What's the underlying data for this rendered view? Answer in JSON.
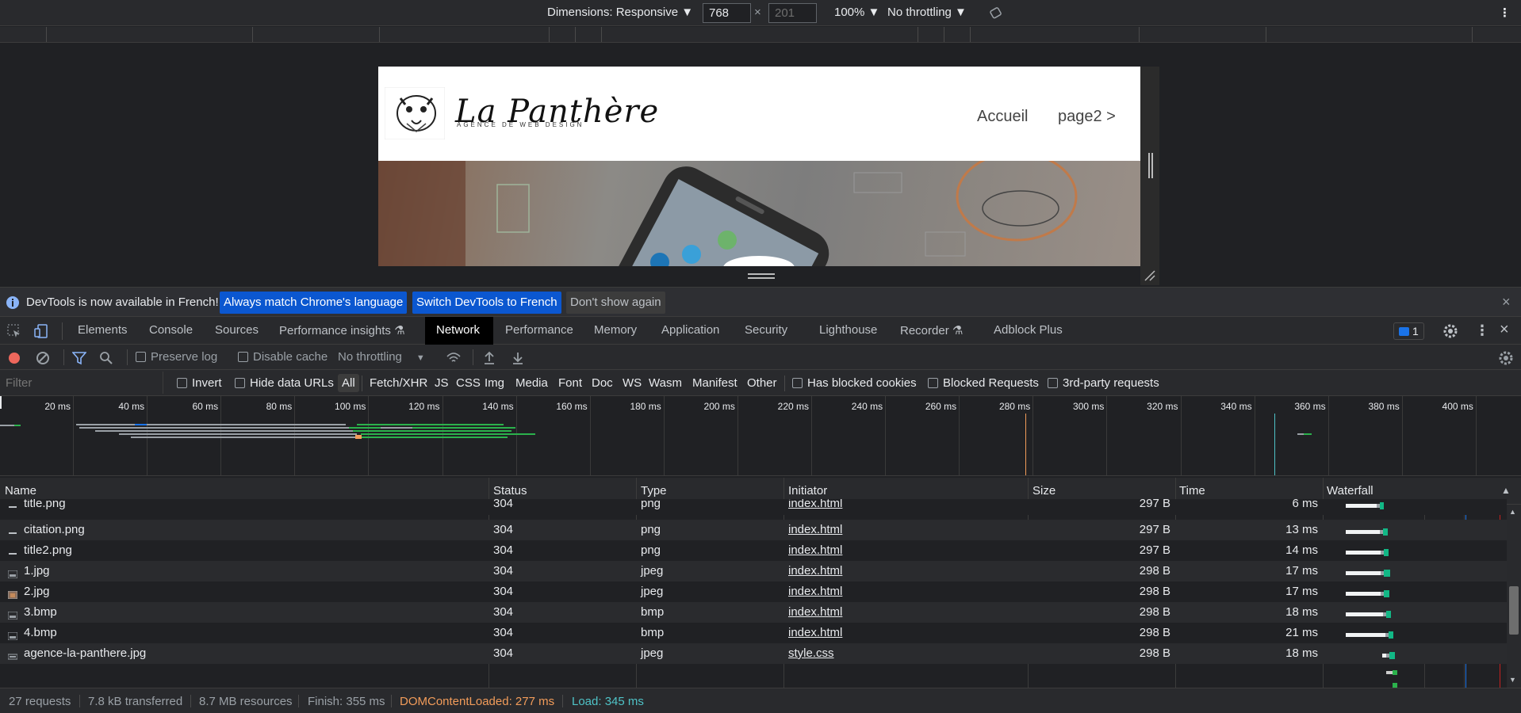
{
  "device_toolbar": {
    "dimensions_label": "Dimensions: Responsive ▼",
    "width_value": "768",
    "times": "×",
    "height_placeholder": "201",
    "zoom": "100% ▼",
    "throttling": "No throttling ▼",
    "more": "⋮"
  },
  "site": {
    "title": "La Panthère",
    "subtitle": "AGENCE DE WEB DESIGN",
    "nav": [
      "Accueil",
      "page2 >"
    ]
  },
  "infobar": {
    "message": "DevTools is now available in French!",
    "btn_match": "Always match Chrome's language",
    "btn_switch": "Switch DevTools to French",
    "btn_dismiss": "Don't show again",
    "close": "×"
  },
  "tabs": [
    "Elements",
    "Console",
    "Sources",
    "Performance insights ⚗",
    "Network",
    "Performance",
    "Memory",
    "Application",
    "Security",
    "Lighthouse",
    "Recorder ⚗",
    "Adblock Plus"
  ],
  "active_tab": "Network",
  "issues_count": "1",
  "network_toolbar": {
    "preserve_log": "Preserve log",
    "disable_cache": "Disable cache",
    "throttling": "No throttling"
  },
  "filter_bar": {
    "placeholder": "Filter",
    "invert": "Invert",
    "hide_data_urls": "Hide data URLs",
    "types": [
      "All",
      "Fetch/XHR",
      "JS",
      "CSS",
      "Img",
      "Media",
      "Font",
      "Doc",
      "WS",
      "Wasm",
      "Manifest",
      "Other"
    ],
    "has_blocked_cookies": "Has blocked cookies",
    "blocked_requests": "Blocked Requests",
    "third_party": "3rd-party requests"
  },
  "overview_ticks": [
    "20 ms",
    "40 ms",
    "60 ms",
    "80 ms",
    "100 ms",
    "120 ms",
    "140 ms",
    "160 ms",
    "180 ms",
    "200 ms",
    "220 ms",
    "240 ms",
    "260 ms",
    "280 ms",
    "300 ms",
    "320 ms",
    "340 ms",
    "360 ms",
    "380 ms",
    "400 ms",
    "4"
  ],
  "columns": [
    "Name",
    "Status",
    "Type",
    "Initiator",
    "Size",
    "Time",
    "Waterfall"
  ],
  "rows": [
    {
      "name": "title.png",
      "status": "304",
      "type": "png",
      "initiator": "index.html",
      "size": "297 B",
      "time": "6 ms",
      "icon": "dash"
    },
    {
      "name": "citation.png",
      "status": "304",
      "type": "png",
      "initiator": "index.html",
      "size": "297 B",
      "time": "13 ms",
      "icon": "dash"
    },
    {
      "name": "title2.png",
      "status": "304",
      "type": "png",
      "initiator": "index.html",
      "size": "297 B",
      "time": "14 ms",
      "icon": "dash"
    },
    {
      "name": "1.jpg",
      "status": "304",
      "type": "jpeg",
      "initiator": "index.html",
      "size": "298 B",
      "time": "17 ms",
      "icon": "image"
    },
    {
      "name": "2.jpg",
      "status": "304",
      "type": "jpeg",
      "initiator": "index.html",
      "size": "298 B",
      "time": "17 ms",
      "icon": "image-orange"
    },
    {
      "name": "3.bmp",
      "status": "304",
      "type": "bmp",
      "initiator": "index.html",
      "size": "298 B",
      "time": "18 ms",
      "icon": "image"
    },
    {
      "name": "4.bmp",
      "status": "304",
      "type": "bmp",
      "initiator": "index.html",
      "size": "298 B",
      "time": "21 ms",
      "icon": "image"
    },
    {
      "name": "agence-la-panthere.jpg",
      "status": "304",
      "type": "jpeg",
      "initiator": "style.css",
      "size": "298 B",
      "time": "18 ms",
      "icon": "image-wide"
    }
  ],
  "status_bar": {
    "requests": "27 requests",
    "transferred": "7.8 kB transferred",
    "resources": "8.7 MB resources",
    "finish": "Finish: 355 ms",
    "dcl": "DOMContentLoaded: 277 ms",
    "load": "Load: 345 ms"
  },
  "colors": {
    "accent": "#1a73e8",
    "dcl": "#f29c5a",
    "load": "#4fc3c7",
    "active_tab_bg": "#000000"
  }
}
